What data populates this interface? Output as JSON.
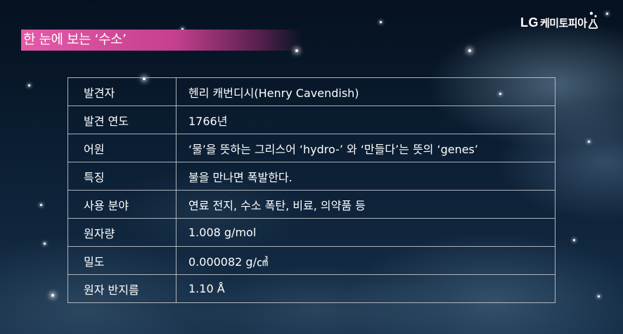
{
  "header": {
    "title": "한 눈에 보는 ‘수소’"
  },
  "logo": {
    "brand": "LG",
    "name": "케미토피아"
  },
  "table": {
    "rows": [
      {
        "label": "발견자",
        "value": "헨리 캐번디시(Henry Cavendish)"
      },
      {
        "label": "발견 연도",
        "value": "1766년"
      },
      {
        "label": "어원",
        "value": "‘물’을 뜻하는 그리스어 ‘hydro-’ 와 ‘만들다’는 뜻의 ‘genes’"
      },
      {
        "label": "특징",
        "value": "불을 만나면 폭발한다."
      },
      {
        "label": "사용 분야",
        "value": "연료 전지, 수소 폭탄, 비료, 의약품 등"
      },
      {
        "label": "원자량",
        "value": "1.008 g/mol"
      },
      {
        "label": "밀도",
        "value": "0.000082 g/㎤"
      },
      {
        "label": "원자 반지름",
        "value": "1.10 Å"
      }
    ]
  },
  "colors": {
    "title_bar": "#e45aa8",
    "background": "#0b1e33",
    "text": "#ffffff",
    "table_border": "#c8cdd4"
  }
}
